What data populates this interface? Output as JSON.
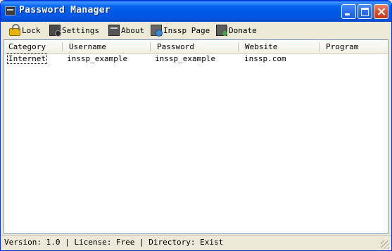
{
  "window": {
    "title": "Password Manager"
  },
  "toolbar": {
    "lock_label": "Lock",
    "settings_label": "Settings",
    "about_label": "About",
    "page_label": "Inssp Page",
    "donate_label": "Donate"
  },
  "table": {
    "columns": [
      "Category",
      "Username",
      "Password",
      "Website",
      "Program"
    ],
    "rows": [
      [
        "Internet",
        "inssp_example",
        "inssp_example",
        "inssp.com",
        ""
      ]
    ]
  },
  "status": {
    "text": "Version: 1.0 | License: Free | Directory: Exist"
  },
  "colors": {
    "titlebar": "#0058E5",
    "chrome": "#ECE9D8",
    "list_border": "#7F9DB9"
  }
}
